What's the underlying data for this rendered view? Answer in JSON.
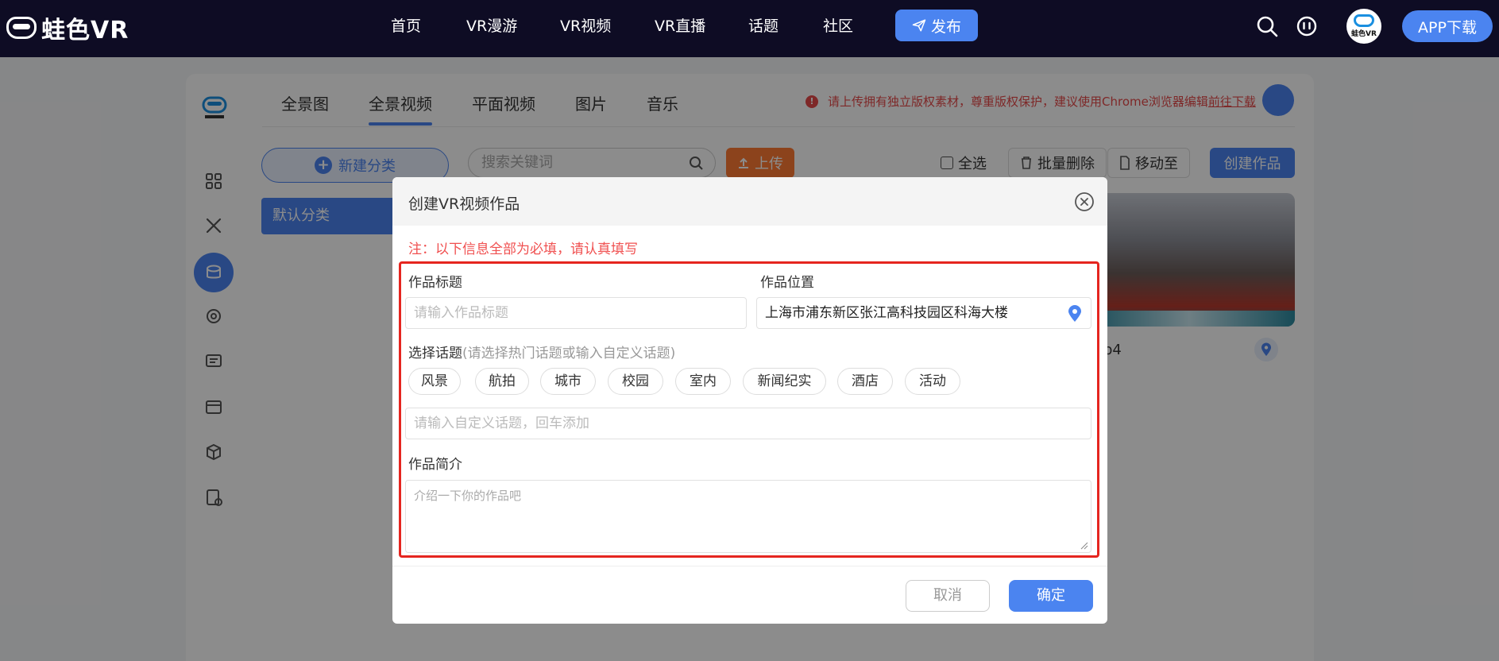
{
  "brand": {
    "logo_text": "蛙色VR",
    "avatar_text": "蛙色VR"
  },
  "topnav": {
    "items": [
      {
        "label": "首页"
      },
      {
        "label": "VR漫游"
      },
      {
        "label": "VR视频"
      },
      {
        "label": "VR直播"
      },
      {
        "label": "话题"
      },
      {
        "label": "社区"
      }
    ],
    "publish_label": "发布",
    "app_download_label": "APP下载"
  },
  "panel": {
    "tabs": [
      {
        "label": "全景图"
      },
      {
        "label": "全景视频",
        "active": true
      },
      {
        "label": "平面视频"
      },
      {
        "label": "图片"
      },
      {
        "label": "音乐"
      }
    ],
    "notice_text": "请上传拥有独立版权素材，尊重版权保护，建议使用Chrome浏览器编辑",
    "notice_link": "前往下载",
    "new_category_label": "新建分类",
    "search_placeholder": "搜索关键词",
    "upload_label": "上传",
    "select_all_label": "全选",
    "batch_delete_label": "批量删除",
    "move_to_label": "移动至",
    "create_work_label": "创建作品",
    "default_category_label": "默认分类",
    "thumb_name_suffix": "p4"
  },
  "modal": {
    "title": "创建VR视频作品",
    "required_note": "注：以下信息全部为必填，请认真填写",
    "work_title_label": "作品标题",
    "work_title_placeholder": "请输入作品标题",
    "location_label": "作品位置",
    "location_value": "上海市浦东新区张江高科技园区科海大楼",
    "topic_label": "选择话题",
    "topic_hint": "(请选择热门话题或输入自定义话题)",
    "topics": [
      {
        "label": "风景"
      },
      {
        "label": "航拍"
      },
      {
        "label": "城市"
      },
      {
        "label": "校园"
      },
      {
        "label": "室内"
      },
      {
        "label": "新闻纪实"
      },
      {
        "label": "酒店"
      },
      {
        "label": "活动"
      }
    ],
    "custom_topic_placeholder": "请输入自定义话题，回车添加",
    "intro_label": "作品简介",
    "intro_placeholder": "介绍一下你的作品吧",
    "cancel_label": "取消",
    "confirm_label": "确定"
  },
  "colors": {
    "brand_blue": "#4b84f0",
    "topbar_bg": "#0e0c24",
    "warning_red": "#e64a4a",
    "upload_orange": "#ff7a33",
    "highlight_frame": "#e5251f"
  }
}
